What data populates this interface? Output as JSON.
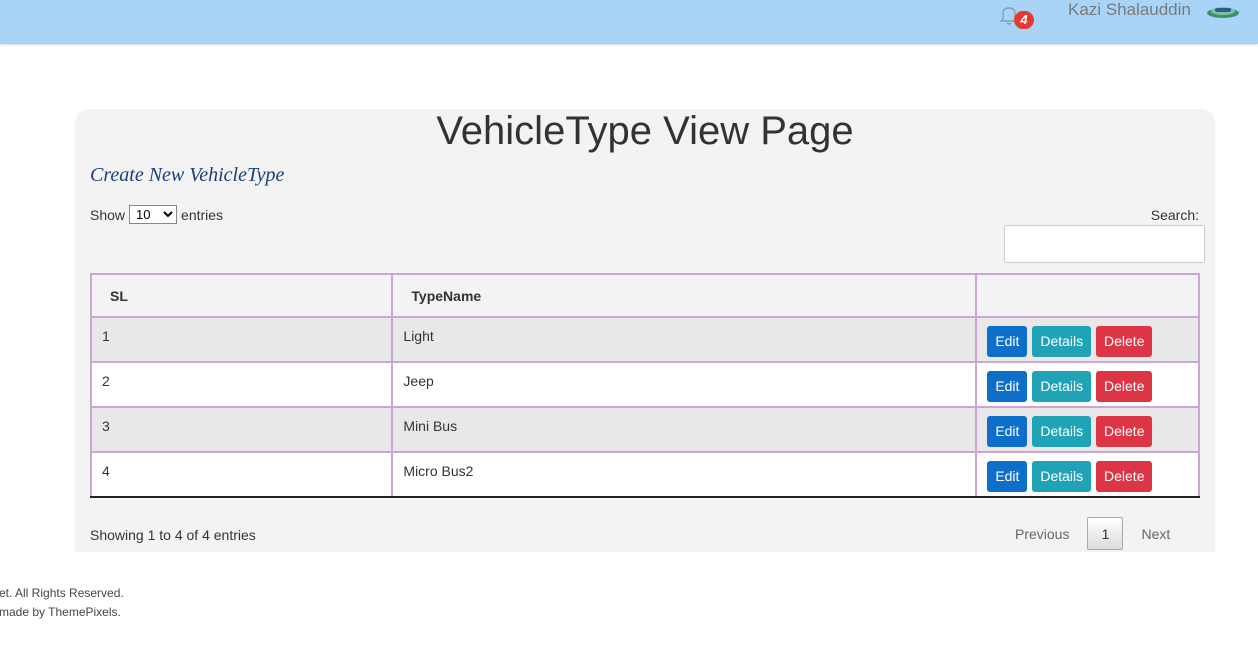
{
  "header": {
    "notification_count": "4",
    "username": "Kazi Shalauddin"
  },
  "page": {
    "title": "VehicleType View Page",
    "create_link": "Create New VehicleType"
  },
  "table_controls": {
    "show_label": "Show",
    "entries_label": "entries",
    "length_value": "10",
    "search_label": "Search:",
    "search_value": ""
  },
  "table": {
    "headers": [
      "SL",
      "TypeName",
      ""
    ],
    "rows": [
      {
        "sl": "1",
        "type_name": "Light"
      },
      {
        "sl": "2",
        "type_name": "Jeep"
      },
      {
        "sl": "3",
        "type_name": "Mini Bus"
      },
      {
        "sl": "4",
        "type_name": "Micro Bus2"
      }
    ],
    "actions": {
      "edit": "Edit",
      "details": "Details",
      "delete": "Delete"
    }
  },
  "pagination": {
    "info": "Showing 1 to 4 of 4 entries",
    "previous": "Previous",
    "current_page": "1",
    "next": "Next"
  },
  "footer": {
    "line1": "et. All Rights Reserved.",
    "line2": "made by ThemePixels."
  },
  "colors": {
    "topbar": "#a8d4f8",
    "edit": "#0d6fc7",
    "details": "#20a3b6",
    "delete": "#dc3545",
    "badge": "#e53935"
  }
}
